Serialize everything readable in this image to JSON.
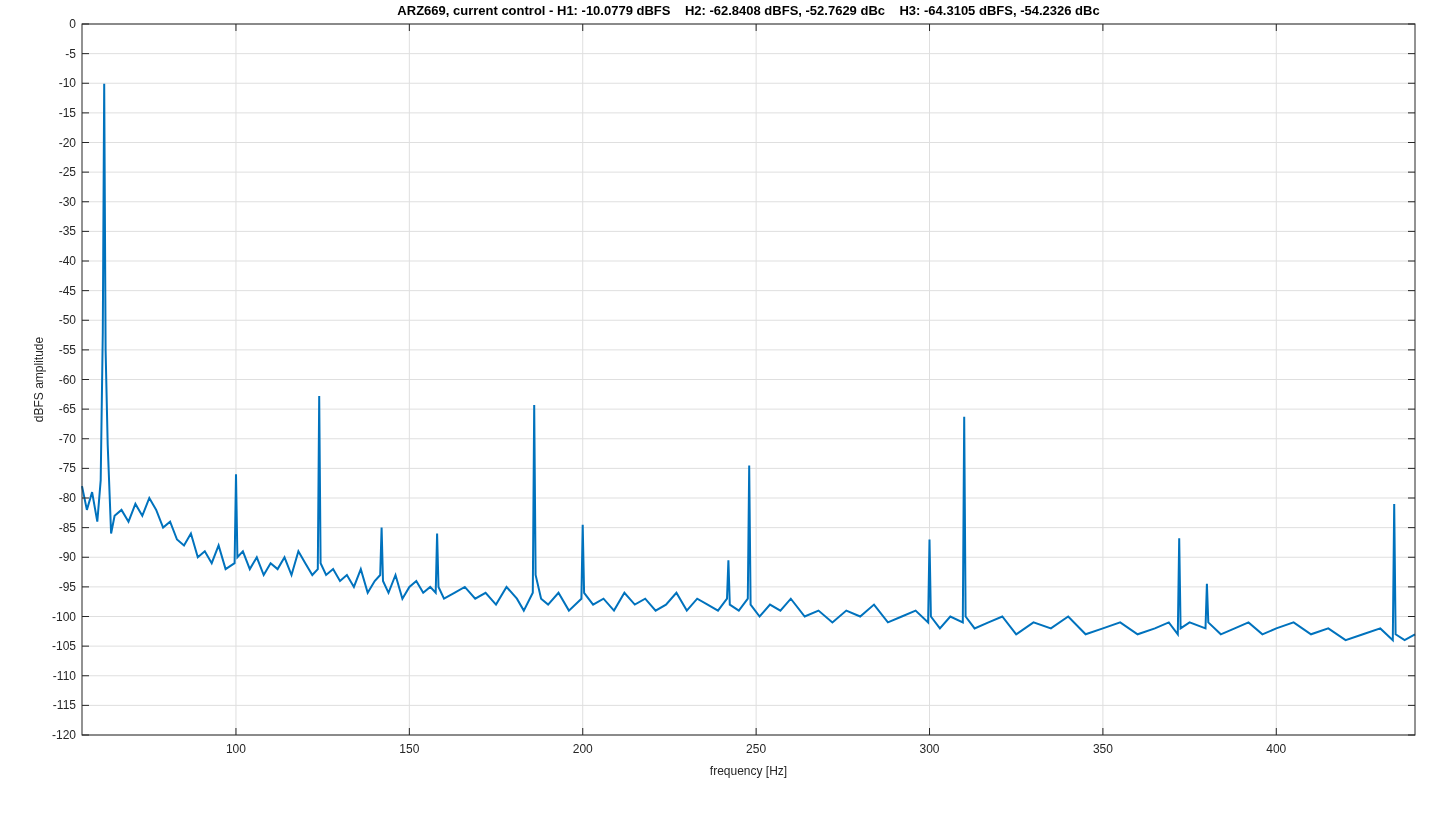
{
  "chart_data": {
    "type": "line",
    "title": "ARZ669, current control - H1: -10.0779 dBFS    H2: -62.8408 dBFS, -52.7629 dBc    H3: -64.3105 dBFS, -54.2326 dBc",
    "xlabel": "frequency [Hz]",
    "ylabel": "dBFS amplitude",
    "x": [
      55.6,
      57,
      58.5,
      60,
      61,
      61.6,
      62,
      62.4,
      63,
      64,
      65,
      67,
      69,
      71,
      73,
      75,
      77,
      79,
      81,
      83,
      85,
      87,
      89,
      91,
      93,
      95,
      97,
      99.6,
      100,
      100.4,
      102,
      104,
      106,
      108,
      110,
      112,
      114,
      116,
      118,
      120,
      122,
      123.6,
      124,
      124.4,
      126,
      128,
      130,
      132,
      134,
      136,
      138,
      140,
      141.6,
      142,
      142.4,
      144,
      146,
      148,
      150,
      152,
      154,
      156,
      157.6,
      158,
      158.4,
      160,
      163,
      166,
      169,
      172,
      175,
      178,
      181,
      183,
      185.6,
      186,
      186.4,
      188,
      190,
      193,
      196,
      199.6,
      200,
      200.4,
      203,
      206,
      209,
      212,
      215,
      218,
      221,
      224,
      227,
      230,
      233,
      236,
      239,
      241.6,
      242,
      242.4,
      245,
      247.6,
      248,
      248.4,
      251,
      254,
      257,
      260,
      264,
      268,
      272,
      276,
      280,
      284,
      288,
      292,
      296,
      299.6,
      300,
      300.4,
      303,
      306,
      309.6,
      310,
      310.4,
      313,
      317,
      321,
      325,
      330,
      335,
      340,
      345,
      350,
      355,
      360,
      365,
      369,
      371.6,
      372,
      372.4,
      375,
      379.6,
      380,
      380.4,
      384,
      388,
      392,
      396,
      400,
      405,
      410,
      415,
      420,
      425,
      430,
      433.6,
      434,
      434.4,
      437,
      440
    ],
    "series": [
      {
        "color": "#0072bd",
        "values": [
          -78,
          -82,
          -79,
          -84,
          -77,
          -52,
          -10.1,
          -55,
          -71,
          -86,
          -83,
          -82,
          -84,
          -81,
          -83,
          -80,
          -82,
          -85,
          -84,
          -87,
          -88,
          -86,
          -90,
          -89,
          -91,
          -88,
          -92,
          -91,
          -76,
          -90,
          -89,
          -92,
          -90,
          -93,
          -91,
          -92,
          -90,
          -93,
          -89,
          -91,
          -93,
          -92,
          -62.8,
          -91,
          -93,
          -92,
          -94,
          -93,
          -95,
          -92,
          -96,
          -94,
          -93,
          -85,
          -94,
          -96,
          -93,
          -97,
          -95,
          -94,
          -96,
          -95,
          -96,
          -86,
          -95,
          -97,
          -96,
          -95,
          -97,
          -96,
          -98,
          -95,
          -97,
          -99,
          -96,
          -64.3,
          -93,
          -97,
          -98,
          -96,
          -99,
          -97,
          -84.5,
          -96,
          -98,
          -97,
          -99,
          -96,
          -98,
          -97,
          -99,
          -98,
          -96,
          -99,
          -97,
          -98,
          -99,
          -97,
          -90.5,
          -98,
          -99,
          -97,
          -74.5,
          -98,
          -100,
          -98,
          -99,
          -97,
          -100,
          -99,
          -101,
          -99,
          -100,
          -98,
          -101,
          -100,
          -99,
          -101,
          -87,
          -100,
          -102,
          -100,
          -101,
          -66.3,
          -100,
          -102,
          -101,
          -100,
          -103,
          -101,
          -102,
          -100,
          -103,
          -102,
          -101,
          -103,
          -102,
          -101,
          -103,
          -86.8,
          -102,
          -101,
          -102,
          -94.5,
          -101,
          -103,
          -102,
          -101,
          -103,
          -102,
          -101,
          -103,
          -102,
          -104,
          -103,
          -102,
          -104,
          -81,
          -103,
          -104,
          -103
        ]
      }
    ],
    "grid": true,
    "xlim": [
      55.6,
      440
    ],
    "ylim": [
      -120,
      0
    ],
    "xticks": [
      100,
      150,
      200,
      250,
      300,
      350,
      400
    ],
    "yticks": [
      0,
      -5,
      -10,
      -15,
      -20,
      -25,
      -30,
      -35,
      -40,
      -45,
      -50,
      -55,
      -60,
      -65,
      -70,
      -75,
      -80,
      -85,
      -90,
      -95,
      -100,
      -105,
      -110,
      -115,
      -120
    ]
  }
}
